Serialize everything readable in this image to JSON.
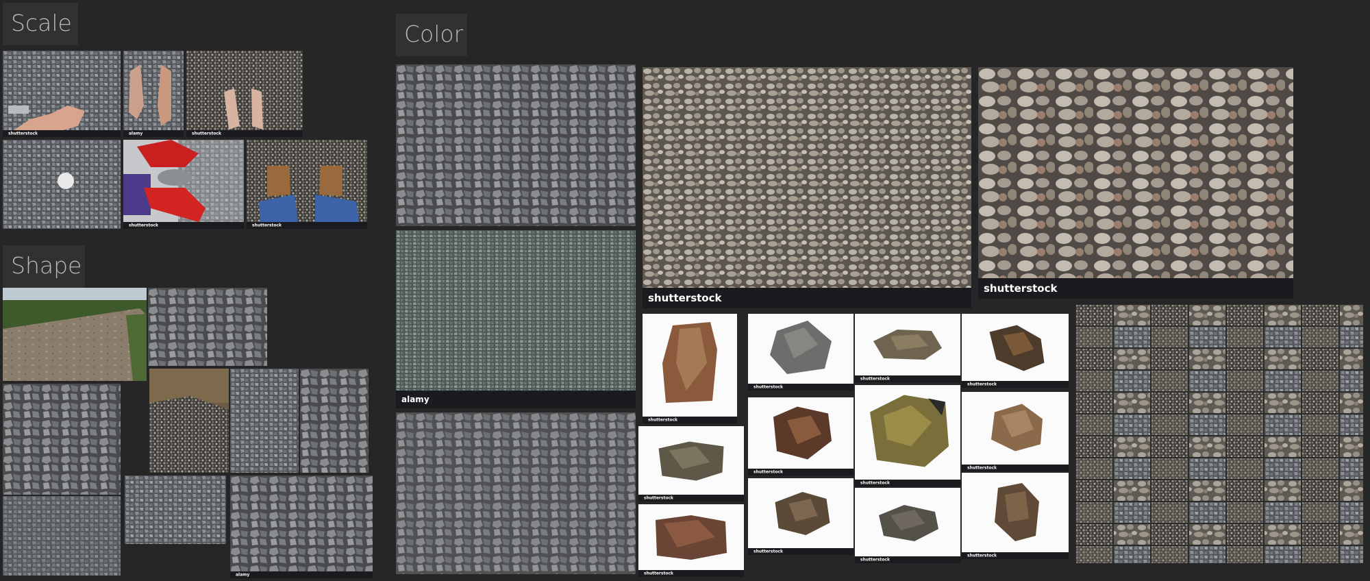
{
  "sections": {
    "scale": "Scale",
    "shape": "Shape",
    "color": "Color"
  },
  "watermarks": {
    "shutterstock": "shutterstock",
    "alamy": "alamy"
  },
  "colors": {
    "background": "#262626",
    "label_bg": "#313131",
    "label_text": "#b9b9b9"
  }
}
